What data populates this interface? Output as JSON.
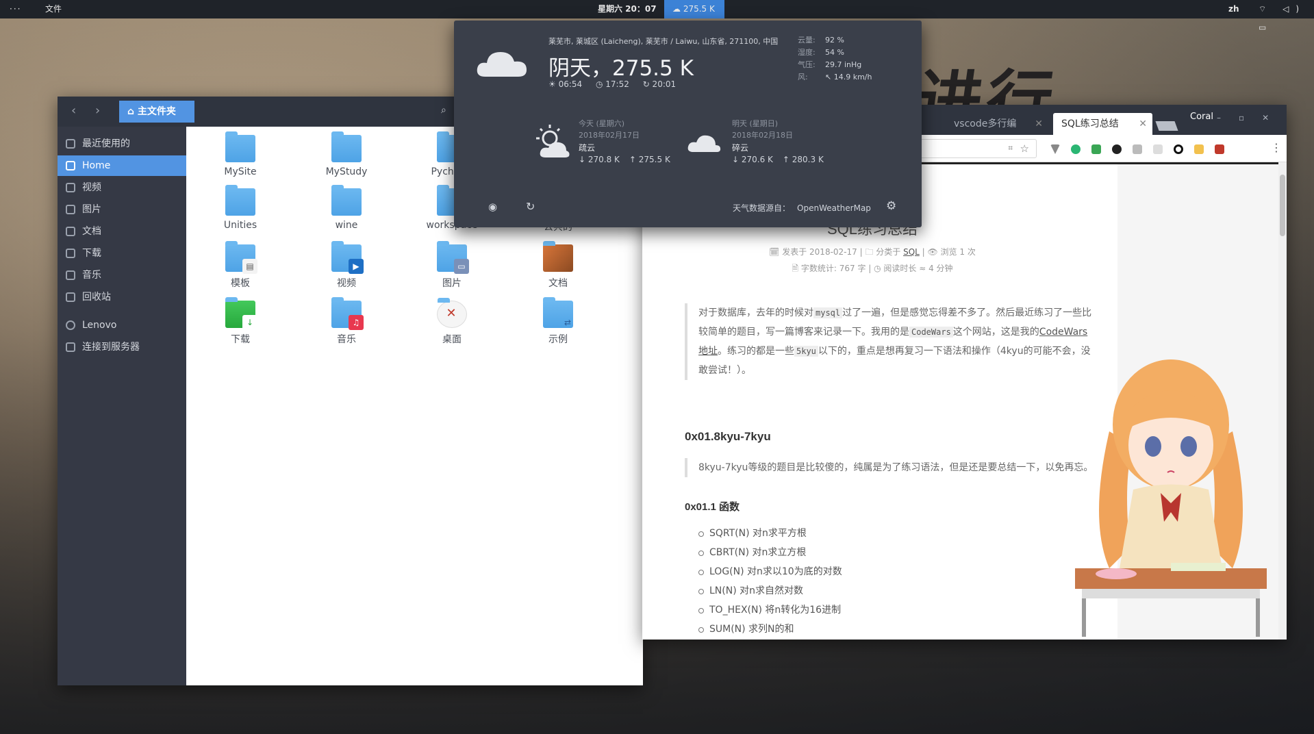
{
  "topbar": {
    "activities": "···",
    "app_menu": "文件",
    "clock": "星期六 20：07",
    "weather": "☁ 275.5 K",
    "lang": "zh",
    "tray": "⌔ ◁) ▭"
  },
  "weather": {
    "location": "莱芜市, 莱城区 (Laicheng), 莱芜市 / Laiwu, 山东省, 271100, 中国",
    "current": "阴天，275.5 K",
    "sunrise": "☀ 06:54",
    "daylength": "◷ 17:52",
    "sunset": "↻ 20:01",
    "stats": [
      {
        "k": "云量:",
        "v": "92 %"
      },
      {
        "k": "湿度:",
        "v": "54 %"
      },
      {
        "k": "气压:",
        "v": "29.7 inHg"
      },
      {
        "k": "风:",
        "v": "↖ 14.9 km/h"
      }
    ],
    "today": {
      "day": "今天 (星期六)",
      "date": "2018年02月17日",
      "cond": "疏云",
      "low": "↓ 270.8 K",
      "high": "↑ 275.5 K"
    },
    "tomorrow": {
      "day": "明天 (星期日)",
      "date": "2018年02月18日",
      "cond": "碎云",
      "low": "↓ 270.6 K",
      "high": "↑ 280.3 K"
    },
    "source_label": "天气数据源自：",
    "source": "OpenWeatherMap",
    "locate_icon": "◉",
    "refresh_icon": "↻",
    "gear_icon": "⚙"
  },
  "filemanager": {
    "back": "‹",
    "forward": "›",
    "crumb": "⌂ 主文件夹",
    "search_icon": "⌕",
    "sidebar": [
      {
        "label": "最近使用的"
      },
      {
        "label": "Home"
      },
      {
        "label": "视频"
      },
      {
        "label": "图片"
      },
      {
        "label": "文档"
      },
      {
        "label": "下载"
      },
      {
        "label": "音乐"
      },
      {
        "label": "回收站"
      },
      {
        "label": "Lenovo"
      },
      {
        "label": "连接到服务器"
      }
    ],
    "files": [
      {
        "name": "MySite"
      },
      {
        "name": "MyStudy"
      },
      {
        "name": "Pycharm"
      },
      {
        "name": "Unities"
      },
      {
        "name": "wine"
      },
      {
        "name": "workspace"
      },
      {
        "name": "公共的"
      },
      {
        "name": "模板"
      },
      {
        "name": "视频"
      },
      {
        "name": "图片"
      },
      {
        "name": "文档"
      },
      {
        "name": "下载"
      },
      {
        "name": "音乐"
      },
      {
        "name": "桌面"
      },
      {
        "name": "示例"
      }
    ]
  },
  "browser": {
    "tabs": [
      {
        "label": "vscode多行编"
      },
      {
        "label": "SQL练习总结"
      }
    ],
    "close": "✕",
    "user": "Coral",
    "winctl": [
      "–",
      "▫",
      "✕"
    ],
    "star": "☆",
    "translate": "⌗",
    "menu": "⋮"
  },
  "article": {
    "title": "SQL练习总结",
    "meta1_pre": "🗓 发表于 2018-02-17 | 🗀 分类于 ",
    "meta1_cat": "SQL",
    "meta1_post": " | 👁 浏览 1 次",
    "meta2": "🗎 字数统计: 767 字 | ◷ 阅读时长 ≈ 4 分钟",
    "p1_a": "对于数据库，去年的时候对",
    "p1_code1": "mysql",
    "p1_b": "过了一遍，但是感觉忘得差不多了。然后最近练习了一些比较简单的题目，写一篇博客来记录一下。我用的是",
    "p1_code2": "CodeWars",
    "p1_c": "这个网站，这是我的",
    "p1_link": "CodeWars地址",
    "p1_d": "。练习的都是一些",
    "p1_code3": "5kyu",
    "p1_e": "以下的，重点是想再复习一下语法和操作（4kyu的可能不会，没敢尝试！）。",
    "h2": "0x01.8kyu-7kyu",
    "p2": "8kyu-7kyu等级的题目是比较傻的，纯属是为了练习语法，但是还是要总结一下，以免再忘。",
    "h3": "0x01.1 函数",
    "list": [
      "SQRT(N) 对n求平方根",
      "CBRT(N) 对n求立方根",
      "LOG(N) 对n求以10为底的对数",
      "LN(N) 对n求自然对数",
      "TO_HEX(N) 将n转化为16进制",
      "SUM(N) 求列N的和"
    ]
  },
  "wallpaper_text": "进行"
}
